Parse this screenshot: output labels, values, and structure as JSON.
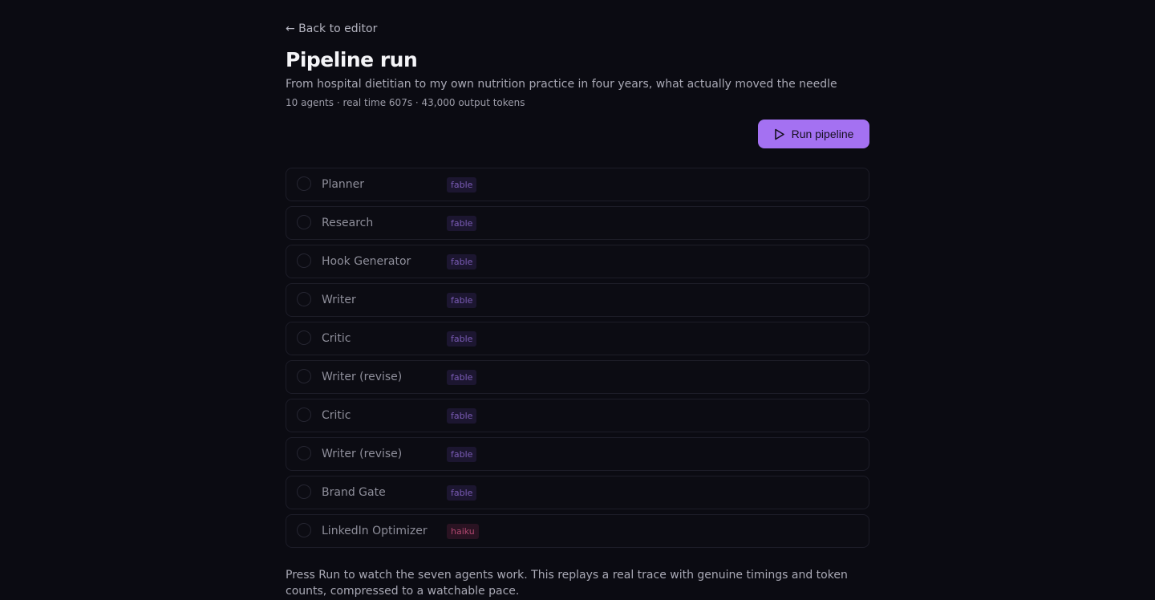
{
  "nav": {
    "back_label": "← Back to editor"
  },
  "header": {
    "title": "Pipeline run",
    "subtitle": "From hospital dietitian to my own nutrition practice in four years, what actually moved the needle",
    "meta": "10 agents · real time 607s · 43,000 output tokens"
  },
  "toolbar": {
    "run_label": "Run pipeline",
    "run_icon": "play-icon"
  },
  "agents": [
    {
      "name": "Planner",
      "model": "fable"
    },
    {
      "name": "Research",
      "model": "fable"
    },
    {
      "name": "Hook Generator",
      "model": "fable"
    },
    {
      "name": "Writer",
      "model": "fable"
    },
    {
      "name": "Critic",
      "model": "fable"
    },
    {
      "name": "Writer (revise)",
      "model": "fable"
    },
    {
      "name": "Critic",
      "model": "fable"
    },
    {
      "name": "Writer (revise)",
      "model": "fable"
    },
    {
      "name": "Brand Gate",
      "model": "fable"
    },
    {
      "name": "LinkedIn Optimizer",
      "model": "haiku"
    }
  ],
  "footer": {
    "note": "Press Run to watch the seven agents work. This replays a real trace with genuine timings and token counts, compressed to a watchable pace."
  },
  "colors": {
    "background": "#0b0b12",
    "accent": "#a471f2",
    "badge_fable": "#7a5bb5",
    "badge_haiku": "#b0476f"
  }
}
